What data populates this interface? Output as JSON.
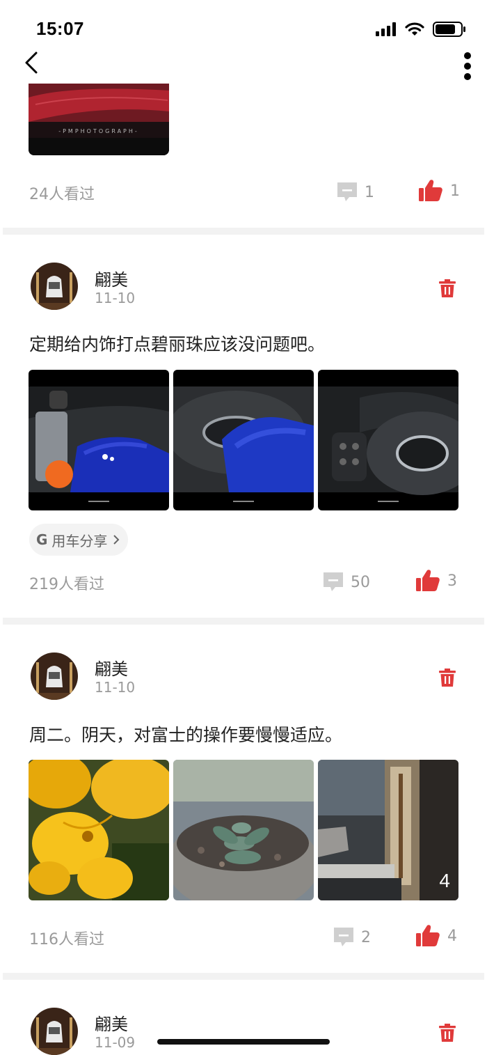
{
  "status": {
    "time": "15:07"
  },
  "top_post": {
    "image_caption": "-PMPHOTOGRAPH-",
    "views": "24人看过",
    "comments": "1",
    "likes": "1"
  },
  "posts": [
    {
      "author": "翩美",
      "date": "11-10",
      "text": "定期给内饰打点碧丽珠应该没问题吧。",
      "tag": "用车分享",
      "tag_icon": "G",
      "views": "219人看过",
      "comments": "50",
      "likes": "3"
    },
    {
      "author": "翩美",
      "date": "11-10",
      "text": "周二。阴天，对富士的操作要慢慢适应。",
      "image_count": "4",
      "views": "116人看过",
      "comments": "2",
      "likes": "4"
    },
    {
      "author": "翩美",
      "date": "11-09"
    }
  ],
  "colors": {
    "accent": "#e03a3a",
    "muted": "#9a9a9a",
    "divider": "#f2f2f2"
  }
}
